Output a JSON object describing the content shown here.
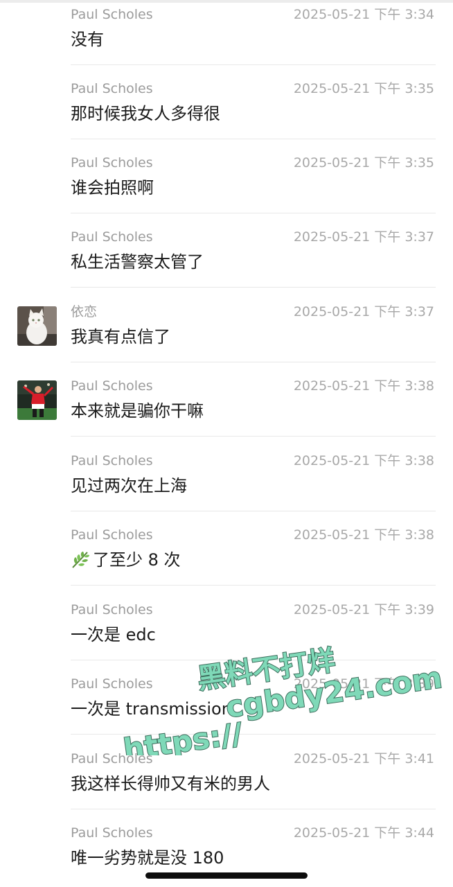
{
  "messages": [
    {
      "sender": "Paul Scholes",
      "time": "2025-05-21 下午 3:34",
      "text": "没有",
      "avatar": null
    },
    {
      "sender": "Paul Scholes",
      "time": "2025-05-21 下午 3:35",
      "text": "那时候我女人多得很",
      "avatar": null
    },
    {
      "sender": "Paul Scholes",
      "time": "2025-05-21 下午 3:35",
      "text": "谁会拍照啊",
      "avatar": null
    },
    {
      "sender": "Paul Scholes",
      "time": "2025-05-21 下午 3:37",
      "text": "私生活警察太管了",
      "avatar": null
    },
    {
      "sender": "依恋",
      "time": "2025-05-21 下午 3:37",
      "text": "我真有点信了",
      "avatar": "cat-avatar"
    },
    {
      "sender": "Paul Scholes",
      "time": "2025-05-21 下午 3:38",
      "text": "本来就是骗你干嘛",
      "avatar": "footballer-avatar"
    },
    {
      "sender": "Paul Scholes",
      "time": "2025-05-21 下午 3:38",
      "text": "见过两次在上海",
      "avatar": null
    },
    {
      "sender": "Paul Scholes",
      "time": "2025-05-21 下午 3:38",
      "text": "了至少 8 次",
      "avatar": null,
      "emoji": "leaf-icon"
    },
    {
      "sender": "Paul Scholes",
      "time": "2025-05-21 下午 3:39",
      "text": "一次是 edc",
      "avatar": null
    },
    {
      "sender": "Paul Scholes",
      "time": "2025-05-21 下午 3:39",
      "text": "一次是 transmission",
      "avatar": null
    },
    {
      "sender": "Paul Scholes",
      "time": "2025-05-21 下午 3:41",
      "text": "我这样长得帅又有米的男人",
      "avatar": null
    },
    {
      "sender": "Paul Scholes",
      "time": "2025-05-21 下午 3:44",
      "text": "唯一劣势就是没 180",
      "avatar": null
    }
  ],
  "watermark": {
    "line1": "黑料不打烊",
    "line2": "cgbdy24.com",
    "line3": "https://"
  },
  "colors": {
    "sender": "#9b9b9b",
    "time": "#a8a8a8",
    "text": "#1a1a1a",
    "divider": "#e8e8e8",
    "watermark_fill": "#7fd9b8",
    "watermark_stroke": "#3b6b5a"
  }
}
